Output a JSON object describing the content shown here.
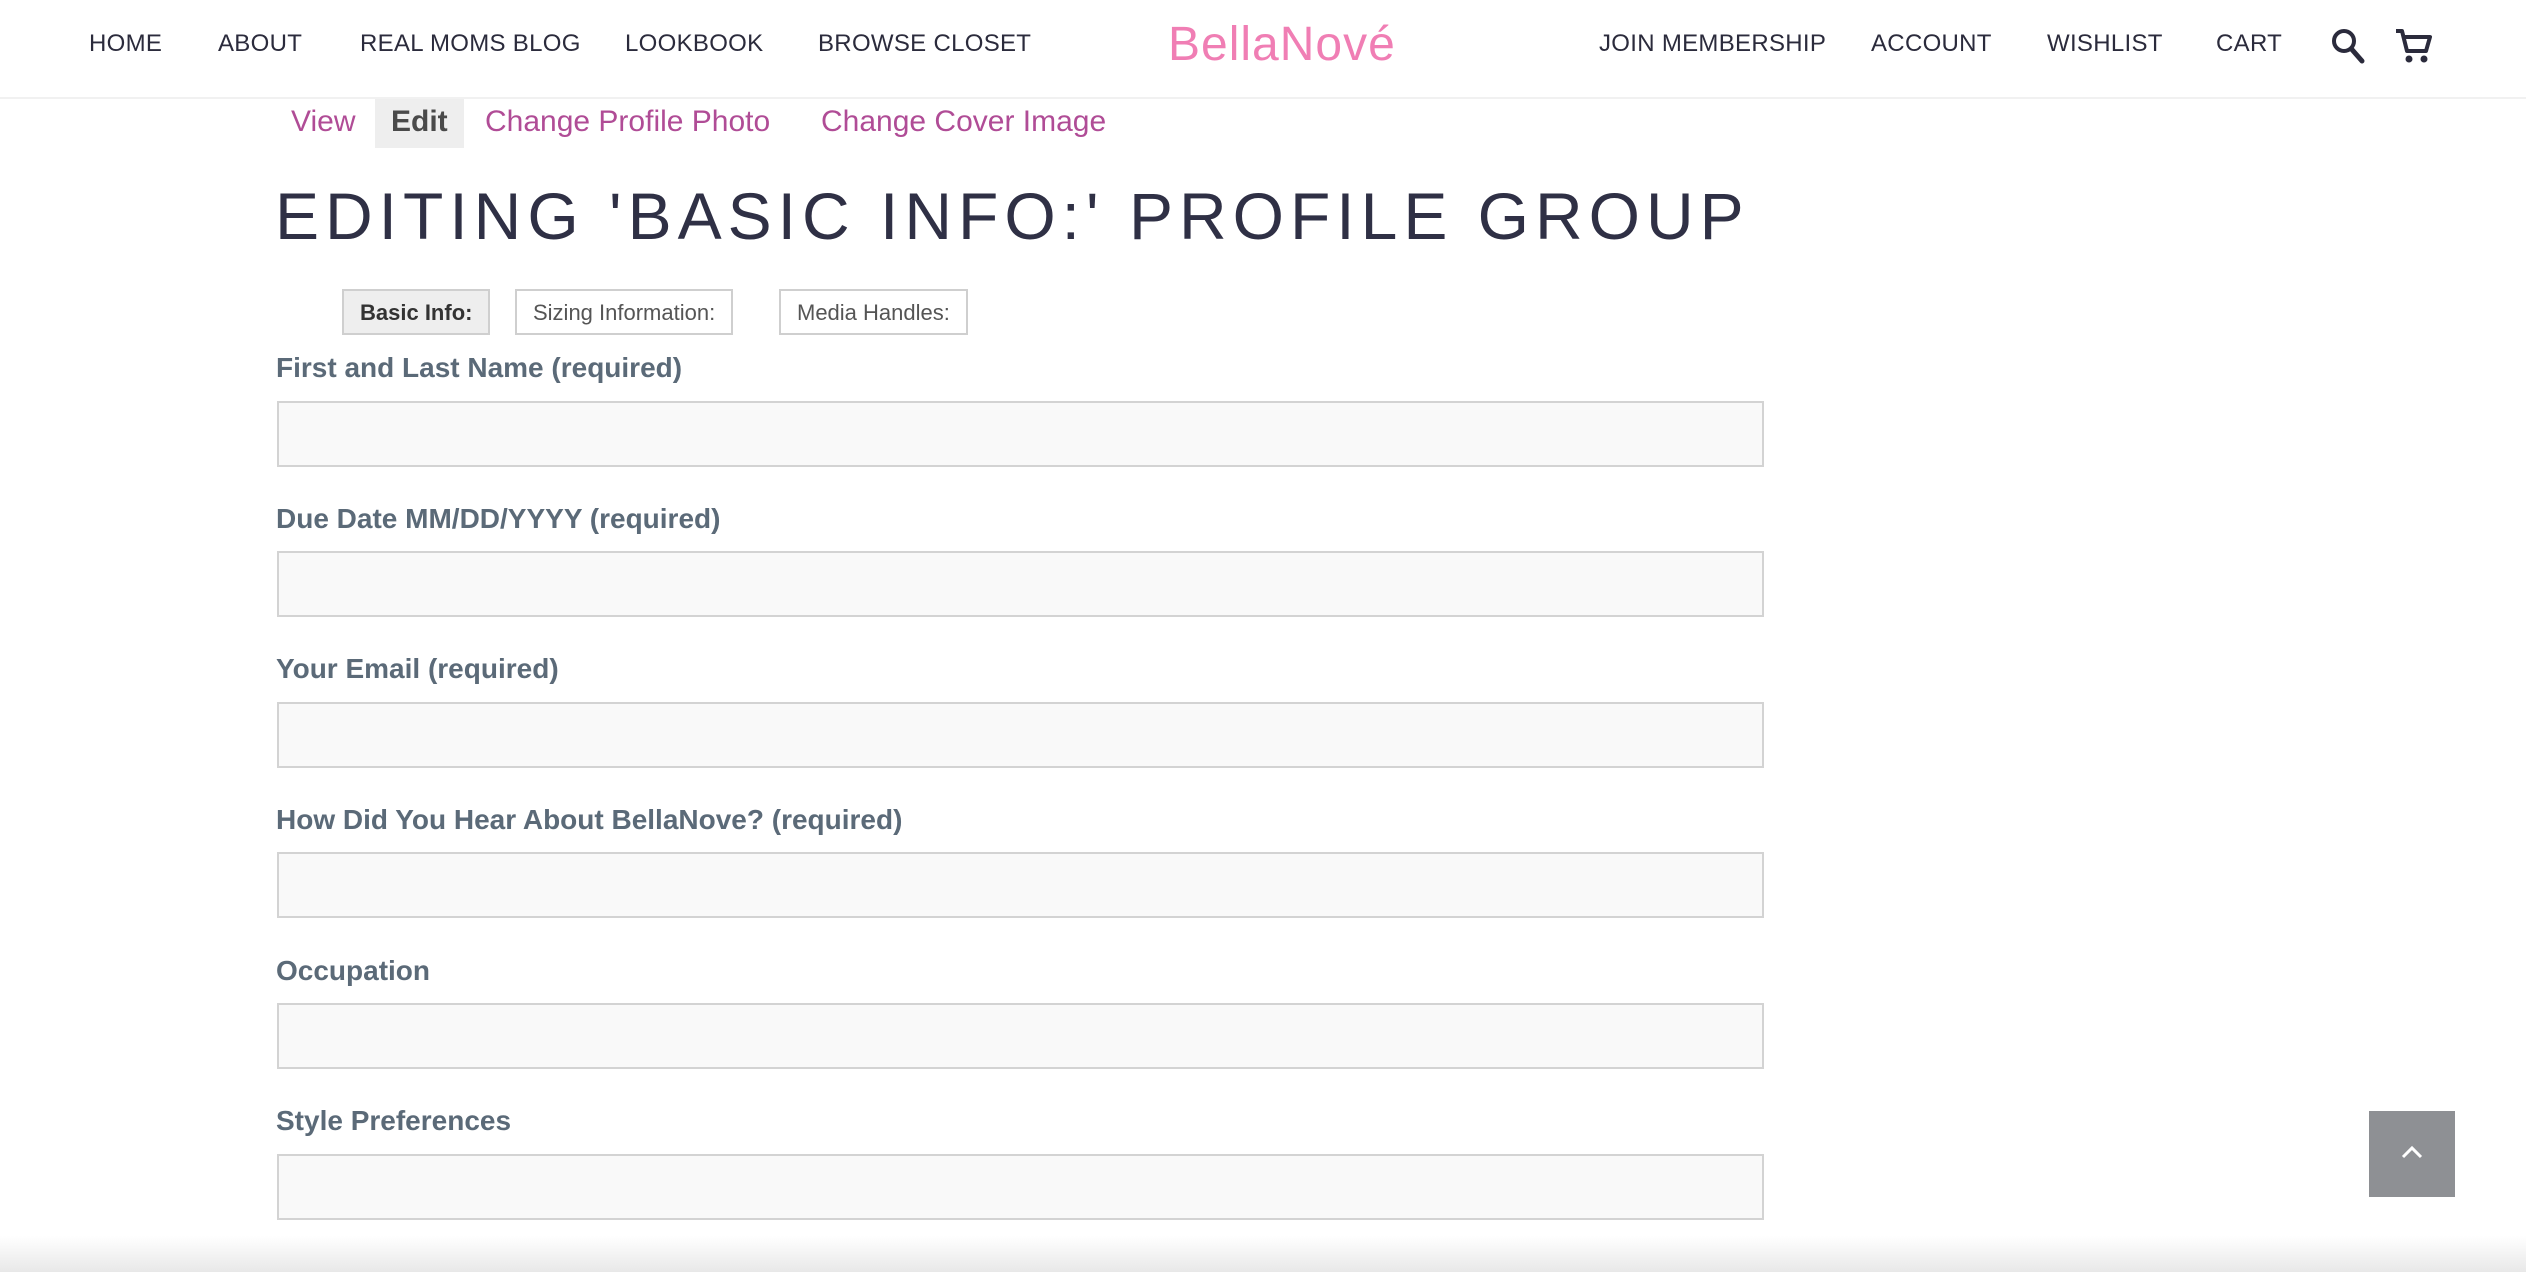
{
  "header": {
    "nav_left": [
      "HOME",
      "ABOUT",
      "REAL MOMS BLOG",
      "LOOKBOOK",
      "BROWSE CLOSET"
    ],
    "logo": "BellaNové",
    "nav_right": [
      "JOIN MEMBERSHIP",
      "ACCOUNT",
      "WISHLIST",
      "CART"
    ],
    "icons": [
      "search-icon",
      "cart-icon"
    ]
  },
  "subnav": {
    "items": [
      "View",
      "Edit",
      "Change Profile Photo",
      "Change Cover Image"
    ],
    "active": "Edit"
  },
  "page_title": "EDITING 'BASIC INFO:' PROFILE GROUP",
  "group_tabs": {
    "items": [
      "Basic Info:",
      "Sizing Information:",
      "Media Handles:"
    ],
    "active": "Basic Info:"
  },
  "form": {
    "fields": [
      {
        "label": "First and Last Name (required)",
        "value": ""
      },
      {
        "label": "Due Date MM/DD/YYYY (required)",
        "value": ""
      },
      {
        "label": "Your Email (required)",
        "value": ""
      },
      {
        "label": "How Did You Hear About BellaNove? (required)",
        "value": ""
      },
      {
        "label": "Occupation",
        "value": ""
      },
      {
        "label": "Style Preferences",
        "value": ""
      }
    ]
  },
  "back_to_top_icon": "chevron-up-icon",
  "colors": {
    "logo": "#f07eb4",
    "subnav_link": "#b04c96",
    "label": "#5b6a78",
    "title": "#2f3045",
    "back_to_top_bg": "#8e9094"
  }
}
